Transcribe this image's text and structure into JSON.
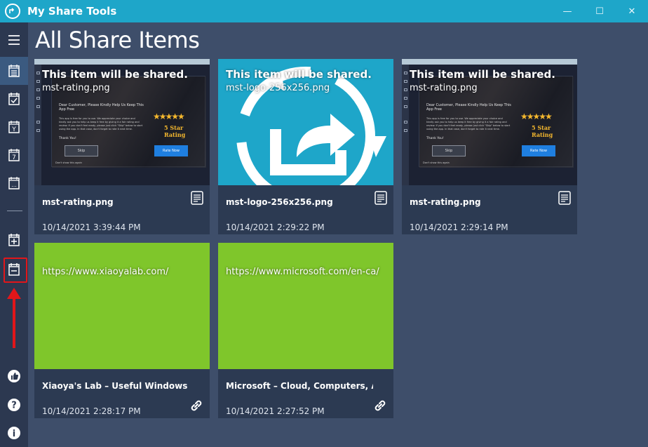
{
  "window": {
    "title": "My Share Tools",
    "minimize_glyph": "—",
    "maximize_glyph": "☐",
    "close_glyph": "✕"
  },
  "page": {
    "title": "All Share Items"
  },
  "sidebar": {
    "items": [
      {
        "icon": "hamburger-menu-icon"
      },
      {
        "icon": "calendar-list-icon",
        "active": true
      },
      {
        "icon": "calendar-check-icon"
      },
      {
        "icon": "calendar-year-icon",
        "glyph": "Y"
      },
      {
        "icon": "calendar-week-icon",
        "glyph": "7"
      },
      {
        "icon": "calendar-more-icon",
        "glyph": "..."
      },
      {
        "icon": "add-item-icon"
      },
      {
        "icon": "remove-item-icon",
        "highlighted": true
      },
      {
        "icon": "thumbs-up-icon"
      },
      {
        "icon": "help-icon",
        "glyph": "?"
      },
      {
        "icon": "info-icon",
        "glyph": "i"
      }
    ]
  },
  "colors": {
    "titlebar": "#1ea6c9",
    "background": "#3e4e6a",
    "sidebar": "#2c3850",
    "card": "#2c3a52",
    "link_tile": "#7fc62b",
    "highlight": "#e2161a"
  },
  "screenshot_thumb": {
    "heading": "Dear Customer, Please Kindly Help Us Keep This App Free",
    "body": "This app is free for you to use. We appreciate your choice and kindly ask you to help us keep it free by giving it a fair rating and review. If you don't feel ready, please just click \"Skip\" below to start using the app. In that case, don't forget to rate it next time.",
    "thanks": "Thank You!",
    "skip": "Skip",
    "rate": "Rate Now",
    "stars": "★★★★★",
    "rating": "5 Star Rating",
    "dont_show": "Don't show this again"
  },
  "items": [
    {
      "overlay_title": "This item will be shared.",
      "overlay_subtitle": "mst-rating.png",
      "name": "mst-rating.png",
      "date": "10/14/2021 3:39:44 PM",
      "kind": "file"
    },
    {
      "overlay_title": "This item will be shared.",
      "overlay_subtitle": "mst-logo-256x256.png",
      "name": "mst-logo-256x256.png",
      "date": "10/14/2021 2:29:22 PM",
      "kind": "file"
    },
    {
      "overlay_title": "This item will be shared.",
      "overlay_subtitle": "mst-rating.png",
      "name": "mst-rating.png",
      "date": "10/14/2021 2:29:14 PM",
      "kind": "file"
    },
    {
      "overlay_title": "https://www.xiaoyalab.com/",
      "name": "Xiaoya's Lab – Useful Windows Utilit...",
      "date": "10/14/2021 2:28:17 PM",
      "kind": "link"
    },
    {
      "overlay_title": "https://www.microsoft.com/en-ca/",
      "name": "Microsoft – Cloud, Computers, Apps...",
      "date": "10/14/2021 2:27:52 PM",
      "kind": "link"
    }
  ]
}
